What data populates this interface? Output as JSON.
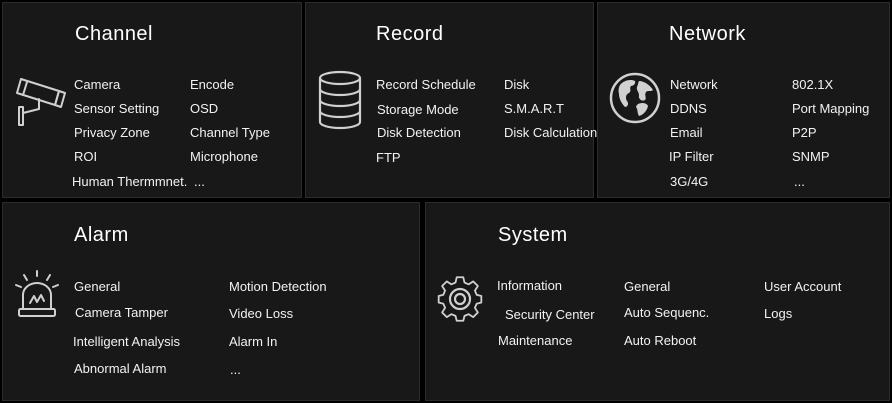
{
  "channel": {
    "title": "Channel",
    "icon": "camera-icon",
    "items": [
      "Camera",
      "Encode",
      "Sensor Setting",
      "OSD",
      "Privacy Zone",
      "Channel Type",
      "ROI",
      "Microphone",
      "Human Thermmnet.",
      "..."
    ]
  },
  "record": {
    "title": "Record",
    "icon": "database-icon",
    "items": [
      "Record Schedule",
      "Disk",
      "Storage Mode",
      "S.M.A.R.T",
      "Disk Detection",
      "Disk Calculation.",
      "FTP"
    ]
  },
  "network": {
    "title": "Network",
    "icon": "globe-icon",
    "items": [
      "Network",
      "802.1X",
      "DDNS",
      "Port Mapping",
      "Email",
      "P2P",
      "IP Filter",
      "SNMP",
      "3G/4G",
      "..."
    ]
  },
  "alarm": {
    "title": "Alarm",
    "icon": "alarm-siren-icon",
    "items": [
      "General",
      "Motion Detection",
      "Camera Tamper",
      "Video Loss",
      "Intelligent Analysis",
      "Alarm In",
      "Abnormal Alarm",
      "..."
    ]
  },
  "system": {
    "title": "System",
    "icon": "gear-icon",
    "items": [
      "Information",
      "General",
      "User Account",
      "Security Center",
      "Auto Sequenc.",
      "Logs",
      "Maintenance",
      "Auto Reboot"
    ]
  },
  "colors": {
    "background": "#000000",
    "panel": "#181818",
    "text": "#ffffff",
    "icon": "#d0d0d0"
  }
}
